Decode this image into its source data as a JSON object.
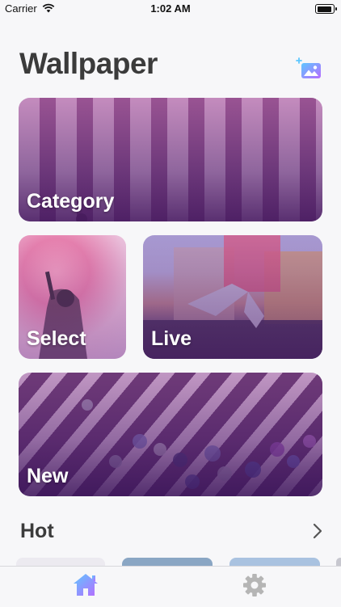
{
  "status_bar": {
    "carrier": "Carrier",
    "time": "1:02 AM",
    "battery_level": 0.9
  },
  "header": {
    "title": "Wallpaper",
    "action_icon": "add-photo-icon"
  },
  "tiles": [
    {
      "label": "Category"
    },
    {
      "label": "Select"
    },
    {
      "label": "Live"
    },
    {
      "label": "New"
    }
  ],
  "hot": {
    "title": "Hot",
    "more_icon": "chevron-right-icon"
  },
  "tab_bar": {
    "items": [
      {
        "icon": "home-icon",
        "selected": true
      },
      {
        "icon": "gear-icon",
        "selected": false
      }
    ]
  },
  "colors": {
    "accent_start": "#5ec7ff",
    "accent_end": "#b86bff",
    "title": "#3b3b3b",
    "inactive_icon": "#b5b5b5"
  }
}
